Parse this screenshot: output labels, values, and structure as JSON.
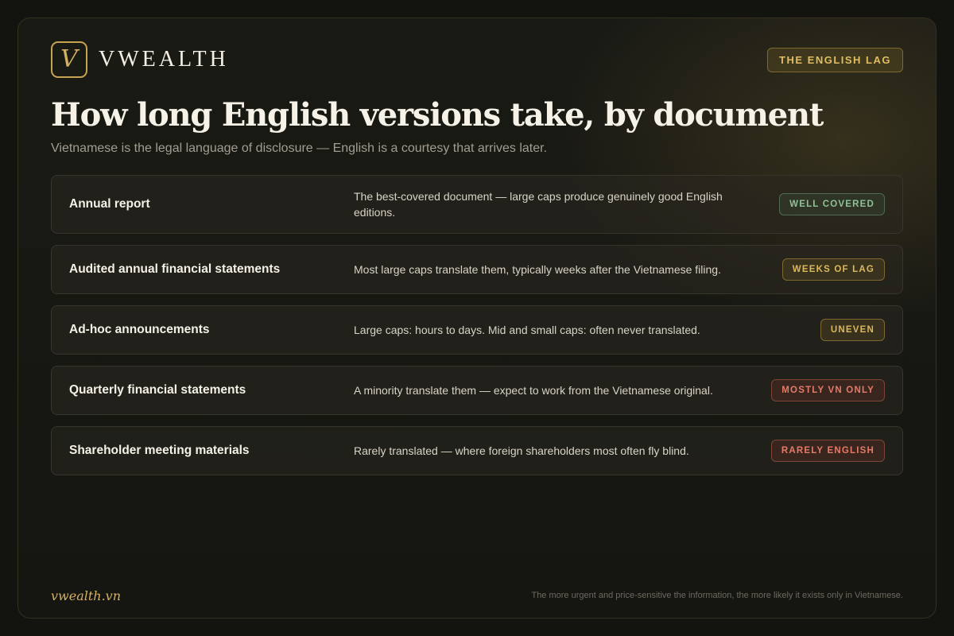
{
  "brand": {
    "logo_letter": "V",
    "name": "VWEALTH"
  },
  "header_badge": "THE ENGLISH LAG",
  "title": "How long English versions take, by document",
  "subtitle": "Vietnamese is the legal language of disclosure — English is a courtesy that arrives later.",
  "rows": [
    {
      "name": "Annual report",
      "description": "The best-covered document — large caps produce genuinely good English editions.",
      "badge": "WELL COVERED",
      "badge_color": "#8fc196"
    },
    {
      "name": "Audited annual financial statements",
      "description": "Most large caps translate them, typically weeks after the Vietnamese filing.",
      "badge": "WEEKS OF LAG",
      "badge_color": "#dcb85c"
    },
    {
      "name": "Ad-hoc announcements",
      "description": "Large caps: hours to days. Mid and small caps: often never translated.",
      "badge": "UNEVEN",
      "badge_color": "#dcb85c"
    },
    {
      "name": "Quarterly financial statements",
      "description": "A minority translate them — expect to work from the Vietnamese original.",
      "badge": "MOSTLY VN ONLY",
      "badge_color": "#e57a68"
    },
    {
      "name": "Shareholder meeting materials",
      "description": "Rarely translated — where foreign shareholders most often fly blind.",
      "badge": "RARELY ENGLISH",
      "badge_color": "#e57a68"
    }
  ],
  "footer": {
    "site": "vwealth.vn",
    "note": "The more urgent and price-sensitive the information, the more likely it exists only in Vietnamese."
  },
  "colors": {
    "accent_gold": "#d4b062",
    "background": "#131310"
  }
}
